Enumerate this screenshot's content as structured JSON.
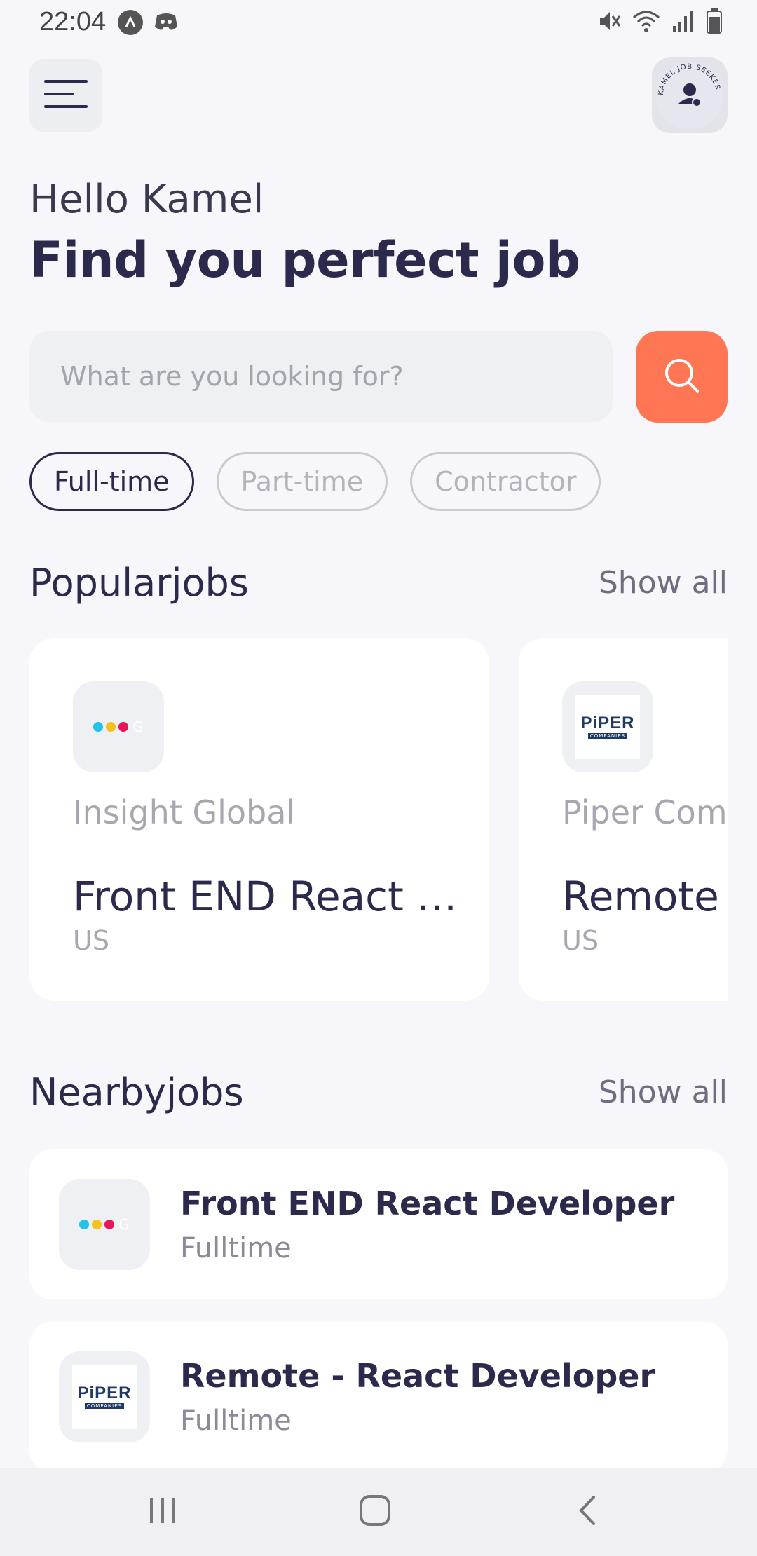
{
  "status_bar": {
    "time": "22:04",
    "icons": [
      "app-notification-icon",
      "discord-icon",
      "mute-icon",
      "wifi-icon",
      "signal-icon",
      "battery-icon"
    ]
  },
  "header": {
    "menu_icon": "hamburger-menu-icon",
    "avatar_text": "KAMEL JOB SEEKER"
  },
  "greeting": "Hello Kamel",
  "headline": "Find you perfect job",
  "search": {
    "placeholder": "What are you looking for?",
    "button_icon": "search-icon"
  },
  "filters": [
    {
      "label": "Full-time",
      "active": true
    },
    {
      "label": "Part-time",
      "active": false
    },
    {
      "label": "Contractor",
      "active": false
    }
  ],
  "popular": {
    "title": "Popularjobs",
    "show_all": "Show all",
    "jobs": [
      {
        "company": "Insight Global",
        "title": "Front END React Developer",
        "country": "US",
        "logo": "insight-global"
      },
      {
        "company": "Piper Companies",
        "title": "Remote - React Developer",
        "country": "US",
        "logo": "piper-companies"
      }
    ]
  },
  "nearby": {
    "title": "Nearbyjobs",
    "show_all": "Show all",
    "jobs": [
      {
        "title": "Front END React Developer",
        "type": "Fulltime",
        "logo": "insight-global"
      },
      {
        "title": "Remote - React Developer",
        "type": "Fulltime",
        "logo": "piper-companies"
      }
    ]
  },
  "logo_text": {
    "piper_main": "PiPER",
    "piper_sub": "COMPANIES",
    "insight_g": "G"
  },
  "colors": {
    "accent": "#ff7654",
    "text_dark": "#2b2a4c",
    "text_muted": "#a6a7b0",
    "background": "#f7f7fb"
  },
  "nav": [
    "recent-apps-icon",
    "home-icon",
    "back-icon"
  ]
}
